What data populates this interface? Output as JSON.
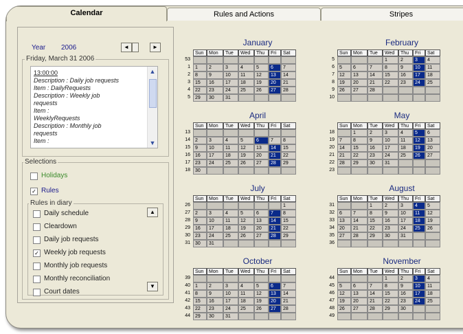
{
  "tabs": [
    {
      "label": "Calendar",
      "active": true
    },
    {
      "label": "Rules and Actions",
      "active": false
    },
    {
      "label": "Stripes",
      "active": false
    }
  ],
  "year": {
    "label": "Year",
    "value": "2006",
    "prev": "◄",
    "next": "►"
  },
  "date_group": {
    "label": "Friday, March 31 2006"
  },
  "notes": [
    {
      "text": "13:00:00",
      "style": "time"
    },
    {
      "text": "Description : Daily job requests"
    },
    {
      "text": "Item :               DailyRequests"
    },
    {
      "text": "Description : Weekly job"
    },
    {
      "text": "requests"
    },
    {
      "text": "Item :"
    },
    {
      "text": "      WeeklyRequests"
    },
    {
      "text": "Description : Monthly job"
    },
    {
      "text": "requests"
    },
    {
      "text": "Item :"
    }
  ],
  "selections": {
    "label": "Selections",
    "items": [
      {
        "label": "Holidays",
        "checked": false,
        "color": "#3a8a2a"
      },
      {
        "label": "Rules",
        "checked": true,
        "color": "#1a1a8c"
      }
    ]
  },
  "diary": {
    "label": "Rules in diary",
    "items": [
      {
        "label": "Daily schedule",
        "checked": false
      },
      {
        "label": "Cleardown",
        "checked": false
      },
      {
        "label": "Daily job requests",
        "checked": false
      },
      {
        "label": "Weekly job requests",
        "checked": true
      },
      {
        "label": "Monthly job requests",
        "checked": false
      },
      {
        "label": "Monthly reconciliation",
        "checked": false
      },
      {
        "label": "Court dates",
        "checked": false
      }
    ]
  },
  "weekdays": [
    "Sun",
    "Mon",
    "Tue",
    "Wed",
    "Thu",
    "Fri",
    "Sat"
  ],
  "colors": {
    "accent": "#0a2a8a",
    "panel": "#ece9d8",
    "cell": "#d4d0c8"
  },
  "months": [
    {
      "name": "January",
      "weeks": [
        {
          "wk": "53",
          "days": [
            "",
            "",
            "",
            "",
            "",
            "",
            ""
          ]
        },
        {
          "wk": "1",
          "days": [
            "1",
            "2",
            "3",
            "4",
            "5",
            "6",
            "7"
          ],
          "sel": [
            5
          ]
        },
        {
          "wk": "2",
          "days": [
            "8",
            "9",
            "10",
            "11",
            "12",
            "13",
            "14"
          ],
          "sel": [
            5
          ]
        },
        {
          "wk": "3",
          "days": [
            "15",
            "16",
            "17",
            "18",
            "19",
            "20",
            "21"
          ],
          "sel": [
            5
          ]
        },
        {
          "wk": "4",
          "days": [
            "22",
            "23",
            "24",
            "25",
            "26",
            "27",
            "28"
          ],
          "sel": [
            5
          ]
        },
        {
          "wk": "5",
          "days": [
            "29",
            "30",
            "31",
            "",
            "",
            "",
            ""
          ]
        }
      ]
    },
    {
      "name": "February",
      "weeks": [
        {
          "wk": "5",
          "days": [
            "",
            "",
            "",
            "1",
            "2",
            "3",
            "4"
          ],
          "sel": [
            5
          ]
        },
        {
          "wk": "6",
          "days": [
            "5",
            "6",
            "7",
            "8",
            "9",
            "10",
            "11"
          ],
          "sel": [
            5
          ]
        },
        {
          "wk": "7",
          "days": [
            "12",
            "13",
            "14",
            "15",
            "16",
            "17",
            "18"
          ],
          "sel": [
            5
          ]
        },
        {
          "wk": "8",
          "days": [
            "19",
            "20",
            "21",
            "22",
            "23",
            "24",
            "25"
          ],
          "sel": [
            5
          ]
        },
        {
          "wk": "9",
          "days": [
            "26",
            "27",
            "28",
            "",
            "",
            "",
            ""
          ]
        },
        {
          "wk": "10",
          "days": [
            "",
            "",
            "",
            "",
            "",
            "",
            ""
          ]
        }
      ]
    },
    {
      "name": "April",
      "weeks": [
        {
          "wk": "13",
          "days": [
            "",
            "",
            "",
            "",
            "",
            "",
            ""
          ]
        },
        {
          "wk": "14",
          "days": [
            "2",
            "3",
            "4",
            "5",
            "6",
            "7",
            "8"
          ],
          "sel": [
            4
          ]
        },
        {
          "wk": "15",
          "days": [
            "9",
            "10",
            "11",
            "12",
            "13",
            "14",
            "15"
          ],
          "sel": [
            5
          ]
        },
        {
          "wk": "16",
          "days": [
            "16",
            "17",
            "18",
            "19",
            "20",
            "21",
            "22"
          ],
          "sel": [
            5
          ]
        },
        {
          "wk": "17",
          "days": [
            "23",
            "24",
            "25",
            "26",
            "27",
            "28",
            "29"
          ],
          "sel": [
            5
          ]
        },
        {
          "wk": "18",
          "days": [
            "30",
            "",
            "",
            "",
            "",
            "",
            ""
          ]
        }
      ]
    },
    {
      "name": "May",
      "weeks": [
        {
          "wk": "18",
          "days": [
            "",
            "1",
            "2",
            "3",
            "4",
            "5",
            "6"
          ],
          "sel": [
            5
          ]
        },
        {
          "wk": "19",
          "days": [
            "7",
            "8",
            "9",
            "10",
            "11",
            "12",
            "13"
          ],
          "sel": [
            5
          ]
        },
        {
          "wk": "20",
          "days": [
            "14",
            "15",
            "16",
            "17",
            "18",
            "19",
            "20"
          ],
          "sel": [
            5
          ]
        },
        {
          "wk": "21",
          "days": [
            "21",
            "22",
            "23",
            "24",
            "25",
            "26",
            "27"
          ],
          "sel": [
            5
          ]
        },
        {
          "wk": "22",
          "days": [
            "28",
            "29",
            "30",
            "31",
            "",
            "",
            ""
          ]
        },
        {
          "wk": "23",
          "days": [
            "",
            "",
            "",
            "",
            "",
            "",
            ""
          ]
        }
      ]
    },
    {
      "name": "July",
      "weeks": [
        {
          "wk": "26",
          "days": [
            "",
            "",
            "",
            "",
            "",
            "",
            "1"
          ]
        },
        {
          "wk": "27",
          "days": [
            "2",
            "3",
            "4",
            "5",
            "6",
            "7",
            "8"
          ],
          "sel": [
            5
          ]
        },
        {
          "wk": "28",
          "days": [
            "9",
            "10",
            "11",
            "12",
            "13",
            "14",
            "15"
          ],
          "sel": [
            5
          ]
        },
        {
          "wk": "29",
          "days": [
            "16",
            "17",
            "18",
            "19",
            "20",
            "21",
            "22"
          ],
          "sel": [
            5
          ]
        },
        {
          "wk": "30",
          "days": [
            "23",
            "24",
            "25",
            "26",
            "27",
            "28",
            "29"
          ],
          "sel": [
            5
          ]
        },
        {
          "wk": "31",
          "days": [
            "30",
            "31",
            "",
            "",
            "",
            "",
            ""
          ]
        }
      ]
    },
    {
      "name": "August",
      "weeks": [
        {
          "wk": "31",
          "days": [
            "",
            "",
            "1",
            "2",
            "3",
            "4",
            "5"
          ],
          "sel": [
            5
          ]
        },
        {
          "wk": "32",
          "days": [
            "6",
            "7",
            "8",
            "9",
            "10",
            "11",
            "12"
          ],
          "sel": [
            5
          ]
        },
        {
          "wk": "33",
          "days": [
            "13",
            "14",
            "15",
            "16",
            "17",
            "18",
            "19"
          ],
          "sel": [
            5
          ]
        },
        {
          "wk": "34",
          "days": [
            "20",
            "21",
            "22",
            "23",
            "24",
            "25",
            "26"
          ],
          "sel": [
            5
          ]
        },
        {
          "wk": "35",
          "days": [
            "27",
            "28",
            "29",
            "30",
            "31",
            "",
            ""
          ]
        },
        {
          "wk": "36",
          "days": [
            "",
            "",
            "",
            "",
            "",
            "",
            ""
          ]
        }
      ]
    },
    {
      "name": "October",
      "weeks": [
        {
          "wk": "39",
          "days": [
            "",
            "",
            "",
            "",
            "",
            "",
            ""
          ]
        },
        {
          "wk": "40",
          "days": [
            "1",
            "2",
            "3",
            "4",
            "5",
            "6",
            "7"
          ],
          "sel": [
            5
          ]
        },
        {
          "wk": "41",
          "days": [
            "8",
            "9",
            "10",
            "11",
            "12",
            "13",
            "14"
          ],
          "sel": [
            5
          ]
        },
        {
          "wk": "42",
          "days": [
            "15",
            "16",
            "17",
            "18",
            "19",
            "20",
            "21"
          ],
          "sel": [
            5
          ]
        },
        {
          "wk": "43",
          "days": [
            "22",
            "23",
            "24",
            "25",
            "26",
            "27",
            "28"
          ],
          "sel": [
            5
          ]
        },
        {
          "wk": "44",
          "days": [
            "29",
            "30",
            "31",
            "",
            "",
            "",
            ""
          ]
        }
      ]
    },
    {
      "name": "November",
      "weeks": [
        {
          "wk": "44",
          "days": [
            "",
            "",
            "",
            "1",
            "2",
            "3",
            "4"
          ],
          "sel": [
            5
          ]
        },
        {
          "wk": "45",
          "days": [
            "5",
            "6",
            "7",
            "8",
            "9",
            "10",
            "11"
          ],
          "sel": [
            5
          ]
        },
        {
          "wk": "46",
          "days": [
            "12",
            "13",
            "14",
            "15",
            "16",
            "17",
            "18"
          ],
          "sel": [
            5
          ]
        },
        {
          "wk": "47",
          "days": [
            "19",
            "20",
            "21",
            "22",
            "23",
            "24",
            "25"
          ],
          "sel": [
            5
          ]
        },
        {
          "wk": "48",
          "days": [
            "26",
            "27",
            "28",
            "29",
            "30",
            "",
            ""
          ]
        },
        {
          "wk": "49",
          "days": [
            "",
            "",
            "",
            "",
            "",
            "",
            ""
          ]
        }
      ]
    }
  ]
}
